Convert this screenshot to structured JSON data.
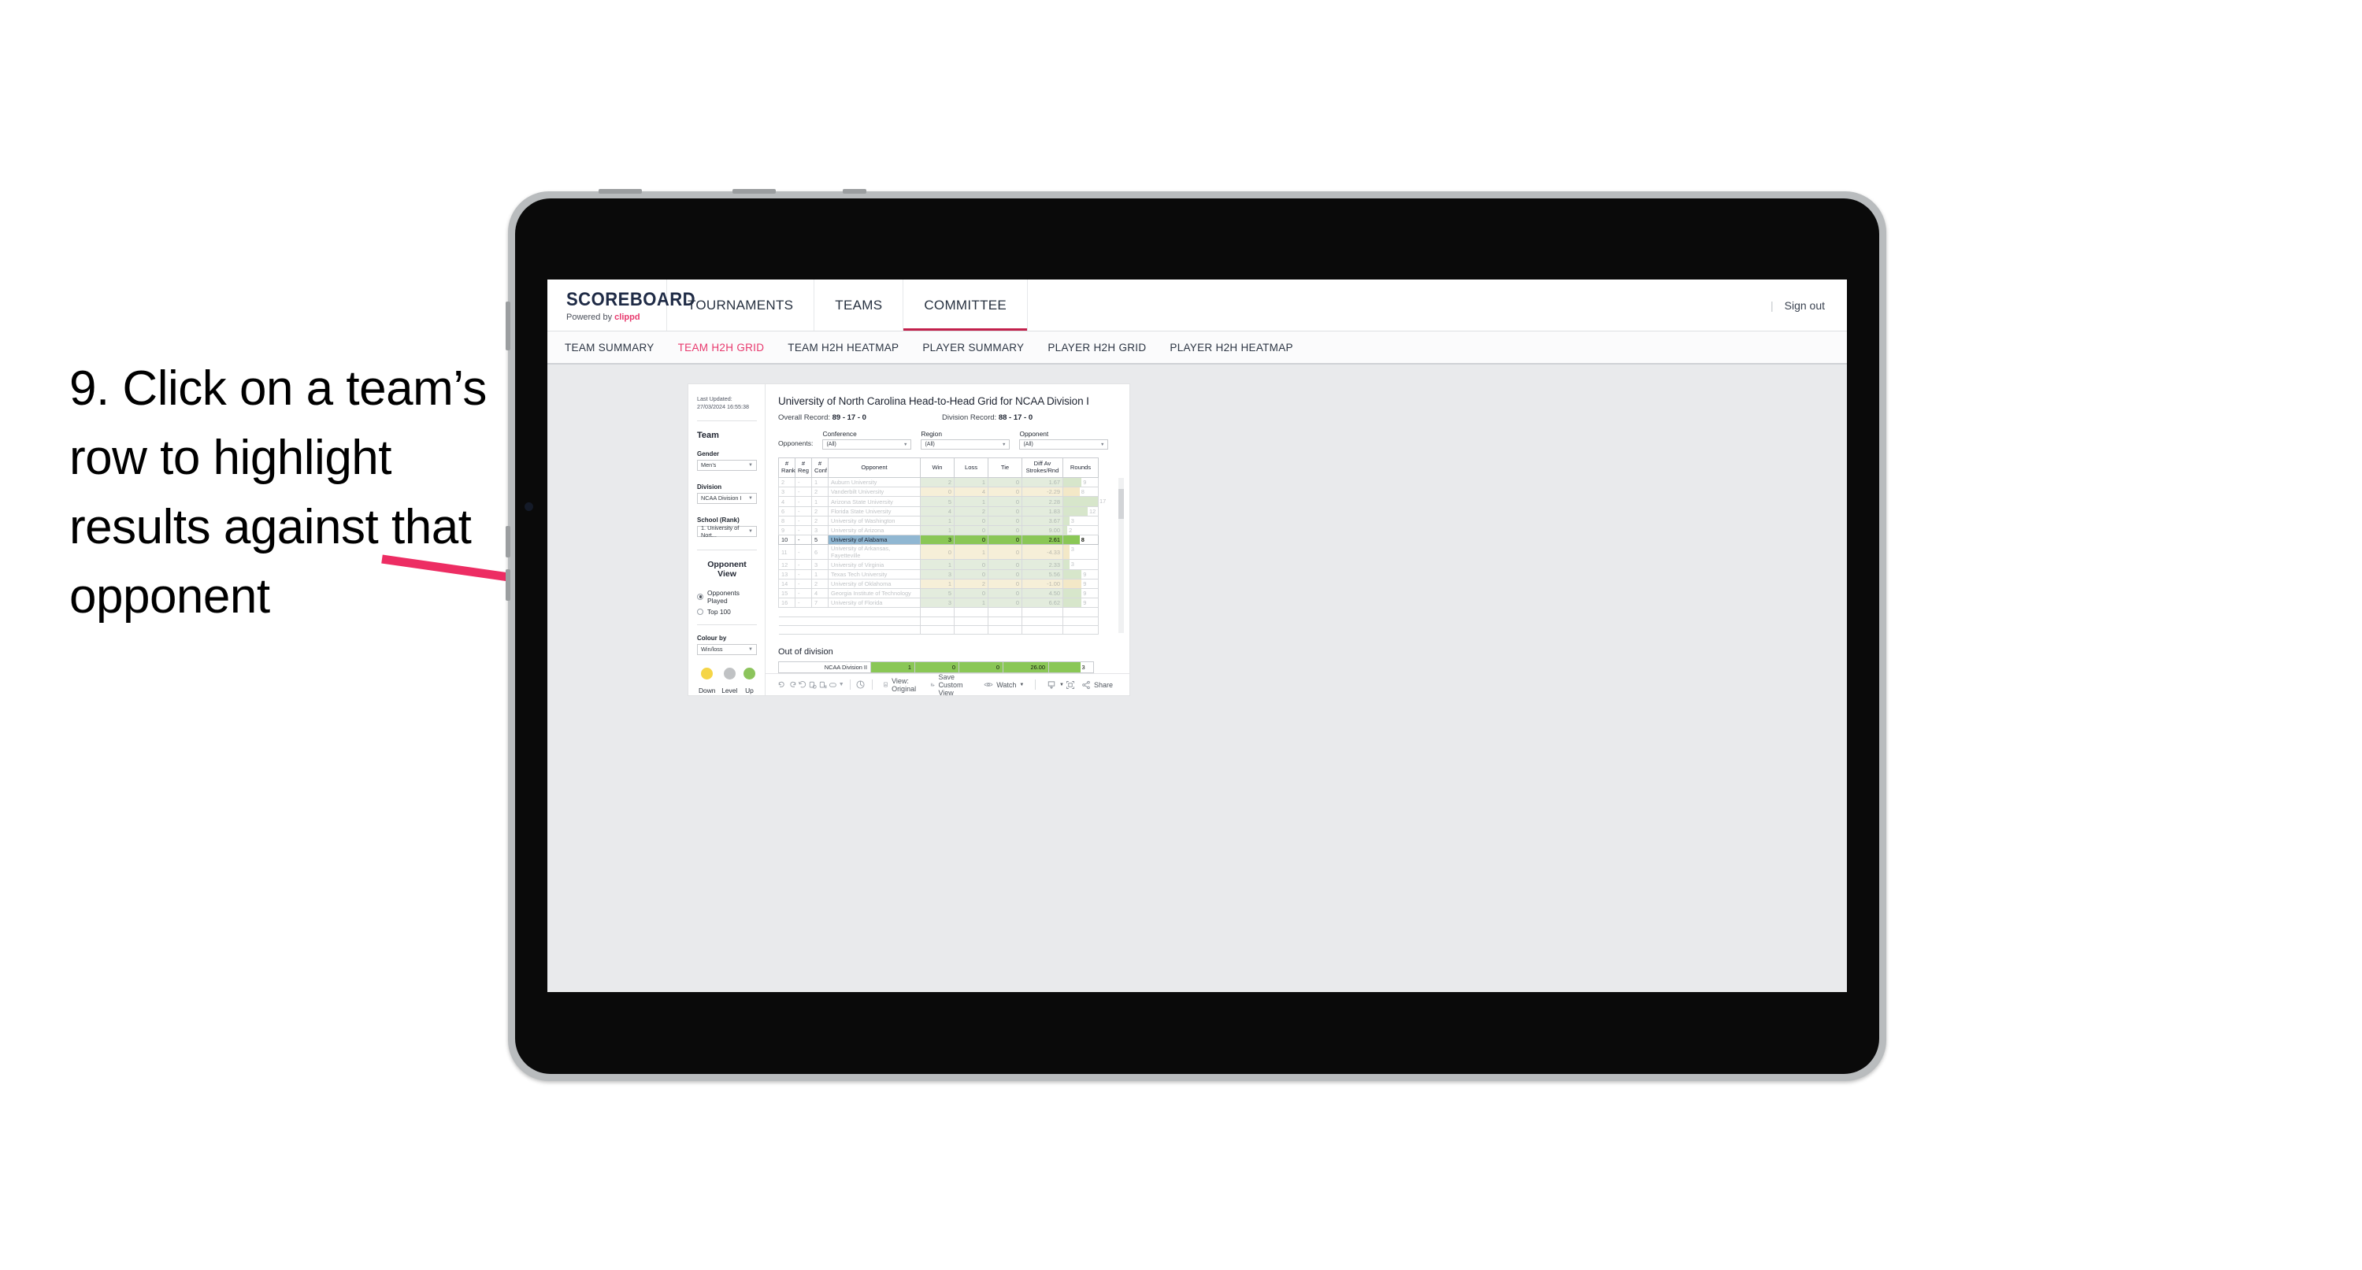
{
  "annotation": {
    "text": "9. Click on a team’s row to highlight results against that opponent",
    "arrow_color": "#ED2D63"
  },
  "app": {
    "logo": {
      "main": "SCOREBOARD",
      "powered_prefix": "Powered by ",
      "brand": "clippd"
    },
    "top_nav": [
      {
        "label": "TOURNAMENTS",
        "active": false
      },
      {
        "label": "TEAMS",
        "active": false
      },
      {
        "label": "COMMITTEE",
        "active": true
      }
    ],
    "header_right": {
      "separator": "|",
      "sign_out": "Sign out"
    },
    "sub_nav": [
      {
        "label": "TEAM SUMMARY",
        "active": false
      },
      {
        "label": "TEAM H2H GRID",
        "active": true
      },
      {
        "label": "TEAM H2H HEATMAP",
        "active": false
      },
      {
        "label": "PLAYER SUMMARY",
        "active": false
      },
      {
        "label": "PLAYER H2H GRID",
        "active": false
      },
      {
        "label": "PLAYER H2H HEATMAP",
        "active": false
      }
    ]
  },
  "sidebar": {
    "last_updated": "Last Updated: 27/03/2024 16:55:38",
    "team_heading": "Team",
    "gender": {
      "label": "Gender",
      "value": "Men’s"
    },
    "division": {
      "label": "Division",
      "value": "NCAA Division I"
    },
    "school": {
      "label": "School (Rank)",
      "value": "1. University of Nort..."
    },
    "opponent_view": {
      "heading": "Opponent View",
      "options": [
        {
          "label": "Opponents Played",
          "selected": true
        },
        {
          "label": "Top 100",
          "selected": false
        }
      ]
    },
    "colour_by": {
      "label": "Colour by",
      "value": "Win/loss"
    },
    "legend": [
      {
        "label": "Down",
        "color": "#F5D547"
      },
      {
        "label": "Level",
        "color": "#C0C2C4"
      },
      {
        "label": "Up",
        "color": "#8CC45C"
      }
    ]
  },
  "viz": {
    "title": "University of North Carolina Head-to-Head Grid for NCAA Division I",
    "overall_record_label": "Overall Record:",
    "overall_record_value": "89 - 17 - 0",
    "division_record_label": "Division Record:",
    "division_record_value": "88 - 17 - 0",
    "filters_label": "Opponents:",
    "filters": [
      {
        "label": "Conference",
        "value": "(All)"
      },
      {
        "label": "Region",
        "value": "(All)"
      },
      {
        "label": "Opponent",
        "value": "(All)"
      }
    ],
    "columns": {
      "rank": "# Rank",
      "rank_l1": "#",
      "rank_l2": "Rank",
      "reg_l1": "#",
      "reg_l2": "Reg",
      "conf_l1": "#",
      "conf_l2": "Conf",
      "opponent": "Opponent",
      "win": "Win",
      "loss": "Loss",
      "tie": "Tie",
      "diff_l1": "Diff Av",
      "diff_l2": "Strokes/Rnd",
      "rounds": "Rounds"
    },
    "out_of_division_title": "Out of division"
  },
  "chart_data": {
    "type": "table",
    "title": "University of North Carolina Head-to-Head Grid for NCAA Division I",
    "columns": [
      "# Rank",
      "# Reg",
      "# Conf",
      "Opponent",
      "Win",
      "Loss",
      "Tie",
      "Diff Av Strokes/Rnd",
      "Rounds"
    ],
    "max_rounds": 17,
    "rows": [
      {
        "rank": "2",
        "reg": "-",
        "conf": "1",
        "opponent": "Auburn University",
        "win": "2",
        "loss": "1",
        "tie": "0",
        "diff": "1.67",
        "rounds": "9",
        "result": "up",
        "selected": false
      },
      {
        "rank": "3",
        "reg": "-",
        "conf": "2",
        "opponent": "Vanderbilt University",
        "win": "0",
        "loss": "4",
        "tie": "0",
        "diff": "-2.29",
        "rounds": "8",
        "result": "down",
        "selected": false
      },
      {
        "rank": "4",
        "reg": "-",
        "conf": "1",
        "opponent": "Arizona State University",
        "win": "5",
        "loss": "1",
        "tie": "0",
        "diff": "2.28",
        "rounds": "17",
        "result": "up",
        "selected": false
      },
      {
        "rank": "6",
        "reg": "-",
        "conf": "2",
        "opponent": "Florida State University",
        "win": "4",
        "loss": "2",
        "tie": "0",
        "diff": "1.83",
        "rounds": "12",
        "result": "up",
        "selected": false
      },
      {
        "rank": "8",
        "reg": "-",
        "conf": "2",
        "opponent": "University of Washington",
        "win": "1",
        "loss": "0",
        "tie": "0",
        "diff": "3.67",
        "rounds": "3",
        "result": "up",
        "selected": false
      },
      {
        "rank": "9",
        "reg": "-",
        "conf": "3",
        "opponent": "University of Arizona",
        "win": "1",
        "loss": "0",
        "tie": "0",
        "diff": "9.00",
        "rounds": "2",
        "result": "up",
        "selected": false
      },
      {
        "rank": "10",
        "reg": "-",
        "conf": "5",
        "opponent": "University of Alabama",
        "win": "3",
        "loss": "0",
        "tie": "0",
        "diff": "2.61",
        "rounds": "8",
        "result": "up",
        "selected": true
      },
      {
        "rank": "11",
        "reg": "-",
        "conf": "6",
        "opponent": "University of Arkansas, Fayetteville",
        "win": "0",
        "loss": "1",
        "tie": "0",
        "diff": "-4.33",
        "rounds": "3",
        "result": "down",
        "selected": false
      },
      {
        "rank": "12",
        "reg": "-",
        "conf": "3",
        "opponent": "University of Virginia",
        "win": "1",
        "loss": "0",
        "tie": "0",
        "diff": "2.33",
        "rounds": "3",
        "result": "up",
        "selected": false
      },
      {
        "rank": "13",
        "reg": "-",
        "conf": "1",
        "opponent": "Texas Tech University",
        "win": "3",
        "loss": "0",
        "tie": "0",
        "diff": "5.56",
        "rounds": "9",
        "result": "up",
        "selected": false
      },
      {
        "rank": "14",
        "reg": "-",
        "conf": "2",
        "opponent": "University of Oklahoma",
        "win": "1",
        "loss": "2",
        "tie": "0",
        "diff": "-1.00",
        "rounds": "9",
        "result": "down",
        "selected": false
      },
      {
        "rank": "15",
        "reg": "-",
        "conf": "4",
        "opponent": "Georgia Institute of Technology",
        "win": "5",
        "loss": "0",
        "tie": "0",
        "diff": "4.50",
        "rounds": "9",
        "result": "up",
        "selected": false
      },
      {
        "rank": "16",
        "reg": "-",
        "conf": "7",
        "opponent": "University of Florida",
        "win": "3",
        "loss": "1",
        "tie": "0",
        "diff": "6.62",
        "rounds": "9",
        "result": "up",
        "selected": false
      }
    ],
    "out_of_division": [
      {
        "opponent": "NCAA Division II",
        "win": "1",
        "loss": "0",
        "tie": "0",
        "diff": "26.00",
        "rounds": "3",
        "result": "up"
      }
    ]
  },
  "toolbar": {
    "view_label": "View: Original",
    "save_label": "Save Custom View",
    "watch_label": "Watch",
    "share_label": "Share"
  }
}
